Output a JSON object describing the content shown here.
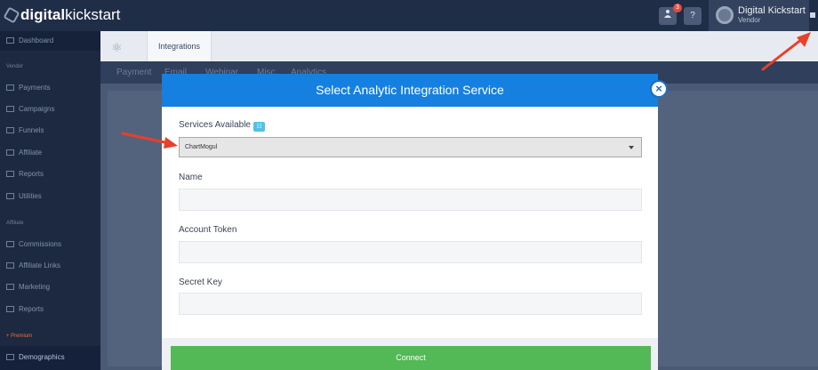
{
  "brand": {
    "name_bold": "digital",
    "name_light": "kickstart"
  },
  "topbar": {
    "notifications_count": "3",
    "help_label": "?",
    "profile_name": "Digital Kickstart",
    "profile_role": "Vendor"
  },
  "sidebar": {
    "items": [
      {
        "label": "Dashboard"
      },
      {
        "label": "Payments"
      },
      {
        "label": "Campaigns"
      },
      {
        "label": "Funnels"
      },
      {
        "label": "Affiliate"
      },
      {
        "label": "Reports"
      },
      {
        "label": "Utilities"
      },
      {
        "label": "Commissions"
      },
      {
        "label": "Affiliate Links"
      },
      {
        "label": "Marketing"
      },
      {
        "label": "Reports"
      },
      {
        "label": "Demographics"
      }
    ],
    "sections": {
      "vendor": "Vendor",
      "affiliate": "Affiliate",
      "premium": "+ Premium"
    }
  },
  "subnav": {
    "tab": "Integrations"
  },
  "tabs": [
    "Payment",
    "Email",
    "Webinar",
    "Misc",
    "Analytics"
  ],
  "modal": {
    "title": "Select Analytic Integration Service",
    "services_label": "Services Available",
    "services_selected": "ChartMogul",
    "name_label": "Name",
    "account_token_label": "Account Token",
    "secret_key_label": "Secret Key",
    "connect_label": "Connect",
    "close_symbol": "×"
  },
  "colors": {
    "header_blue": "#1580e0",
    "connect_green": "#53b856",
    "arrow_red": "#e8402a"
  }
}
